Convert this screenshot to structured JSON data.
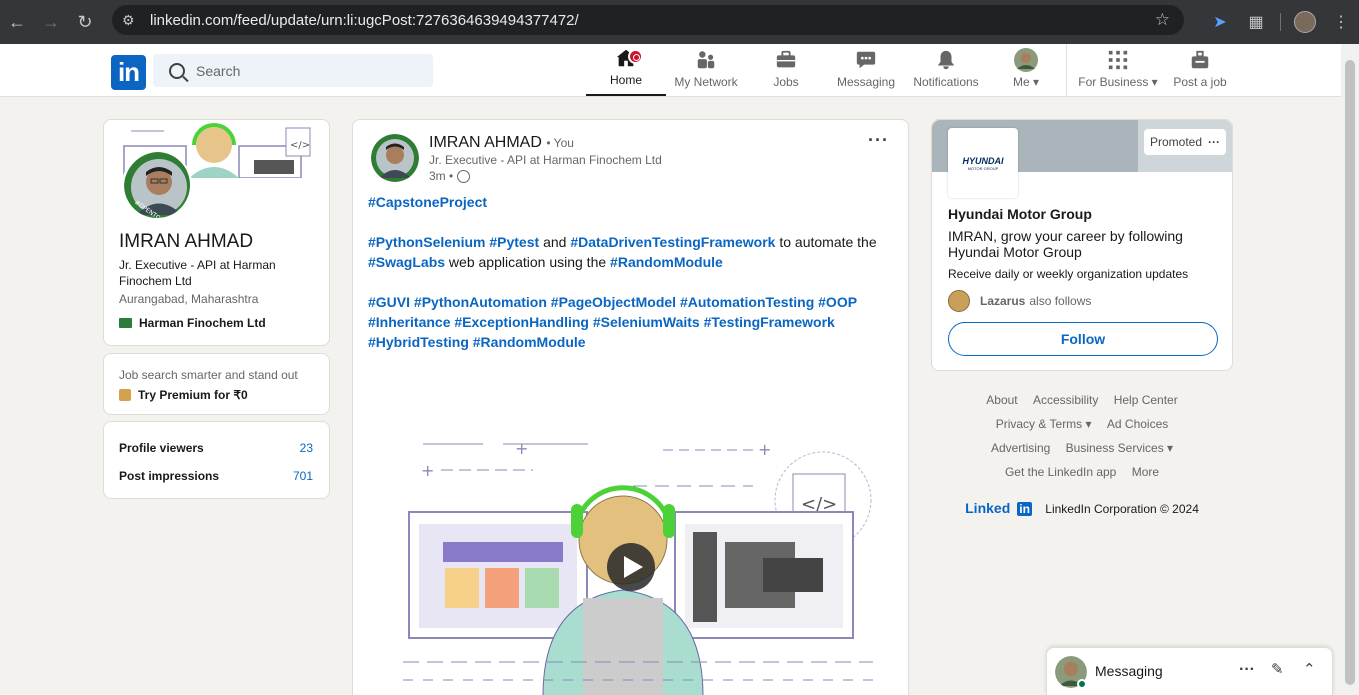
{
  "browser": {
    "url": "linkedin.com/feed/update/urn:li:ugcPost:7276364639494377472/"
  },
  "nav": {
    "logo": "in",
    "search_placeholder": "Search",
    "items": [
      {
        "label": "Home"
      },
      {
        "label": "My Network"
      },
      {
        "label": "Jobs"
      },
      {
        "label": "Messaging"
      },
      {
        "label": "Notifications"
      },
      {
        "label": "Me"
      },
      {
        "label": "For Business"
      },
      {
        "label": "Post a job"
      }
    ]
  },
  "profile": {
    "name": "IMRAN AHMAD",
    "headline": "Jr. Executive - API at Harman Finochem Ltd",
    "location": "Aurangabad, Maharashtra",
    "company": "Harman Finochem Ltd",
    "open_to_work_badge": "#OPENTOWORK",
    "premium_prompt": "Job search smarter and stand out",
    "premium_cta": "Try Premium for ₹0",
    "stats": [
      {
        "label": "Profile viewers",
        "value": "23"
      },
      {
        "label": "Post impressions",
        "value": "701"
      }
    ]
  },
  "post": {
    "author": "IMRAN AHMAD",
    "relation": "• You",
    "headline": "Jr. Executive - API at Harman Finochem Ltd",
    "time": "3m •",
    "line1": "#CapstoneProject",
    "line2_tags": [
      "#PythonSelenium",
      "#Pytest"
    ],
    "line2_and": "and",
    "line2_tag3": "#DataDrivenTestingFramework",
    "line2_text": "to automate the",
    "line3_tag1": "#SwagLabs",
    "line3_text": "web application using the",
    "line3_tag2": "#RandomModule",
    "tags_block": [
      "#GUVI",
      "#PythonAutomation",
      "#PageObjectModel",
      "#AutomationTesting",
      "#OOP",
      "#Inheritance",
      "#ExceptionHandling",
      "#SeleniumWaits",
      "#TestingFramework",
      "#HybridTesting",
      "#RandomModule"
    ],
    "more_label": "···"
  },
  "ad": {
    "promoted": "Promoted",
    "company_logo_text": "HYUNDAI",
    "company_logo_sub": "MOTOR GROUP",
    "company": "Hyundai Motor Group",
    "message": "IMRAN, grow your career by following Hyundai Motor Group",
    "sub": "Receive daily or weekly organization updates",
    "follower_name": "Lazarus",
    "follower_text": "also follows",
    "follow_label": "Follow"
  },
  "footer": {
    "links_row1": [
      "About",
      "Accessibility",
      "Help Center"
    ],
    "links_row2": [
      "Privacy & Terms ▾",
      "Ad Choices"
    ],
    "links_row3": [
      "Advertising",
      "Business Services ▾"
    ],
    "links_row4": [
      "Get the LinkedIn app",
      "More"
    ],
    "brand": "Linked",
    "copyright": "LinkedIn Corporation © 2024"
  },
  "messaging": {
    "title": "Messaging"
  },
  "colors": {
    "brand": "#0a66c2",
    "notification_badge": "#cb112d",
    "page_bg": "#f4f2ee"
  }
}
